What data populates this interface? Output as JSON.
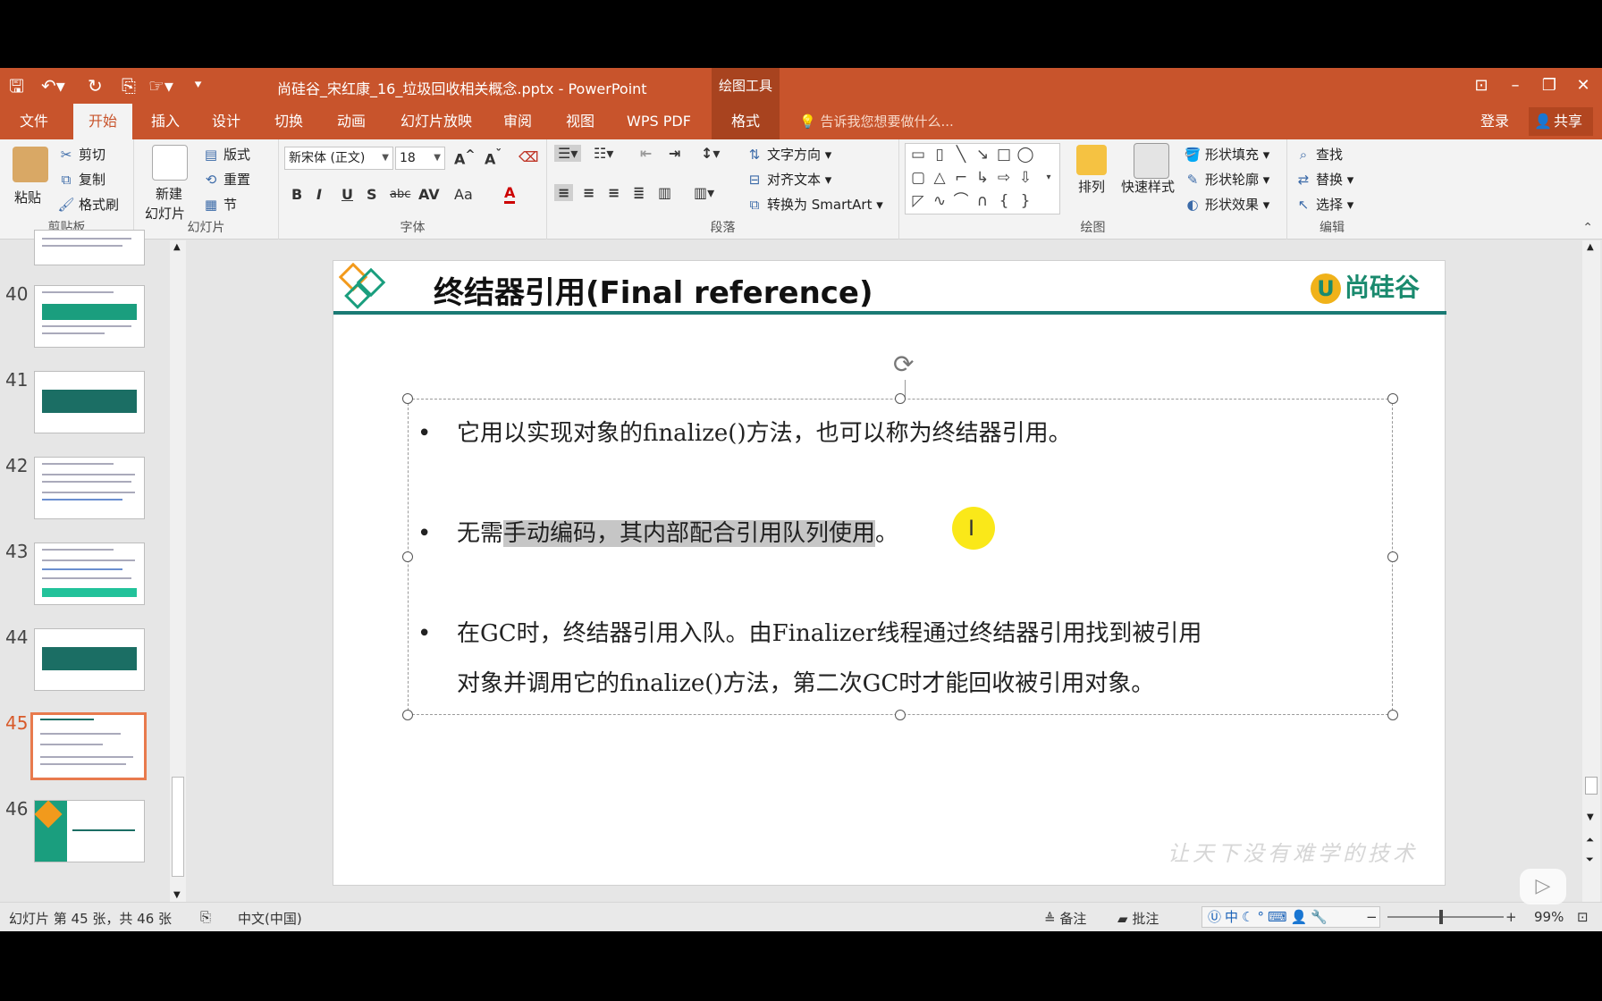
{
  "titlebar": {
    "doc_title": "尚硅谷_宋红康_16_垃圾回收相关概念.pptx - PowerPoint",
    "context_title": "绘图工具",
    "save_icon": "save-icon",
    "undo_icon": "undo-icon",
    "redo_icon": "redo-icon"
  },
  "tabs": [
    "文件",
    "开始",
    "插入",
    "设计",
    "切换",
    "动画",
    "幻灯片放映",
    "审阅",
    "视图",
    "WPS PDF",
    "格式"
  ],
  "active_tab": "开始",
  "tellme": "告诉我您想要做什么...",
  "account": {
    "login": "登录",
    "share": "共享"
  },
  "ribbon": {
    "clipboard": {
      "label": "剪贴板",
      "paste": "粘贴",
      "cut": "剪切",
      "copy": "复制",
      "painter": "格式刷"
    },
    "slides": {
      "label": "幻灯片",
      "new_slide_1": "新建",
      "new_slide_2": "幻灯片",
      "layout": "版式",
      "reset": "重置",
      "section": "节"
    },
    "font": {
      "label": "字体",
      "font_name": "新宋体 (正文)",
      "font_size": "18",
      "bold": "B",
      "italic": "I",
      "underline": "U",
      "shadow": "S",
      "strike": "abc",
      "spacing": "AV",
      "case": "Aa",
      "color": "A"
    },
    "paragraph": {
      "label": "段落",
      "text_direction": "文字方向",
      "align_text": "对齐文本",
      "smartart": "转换为 SmartArt"
    },
    "drawing": {
      "label": "绘图",
      "arrange": "排列",
      "quick_styles": "快速样式",
      "shape_fill": "形状填充",
      "shape_outline": "形状轮廓",
      "shape_effects": "形状效果"
    },
    "editing": {
      "label": "编辑",
      "find": "查找",
      "replace": "替换",
      "select": "选择"
    }
  },
  "thumbnails": [
    {
      "num": "40",
      "kind": "content-bar"
    },
    {
      "num": "41",
      "kind": "section"
    },
    {
      "num": "42",
      "kind": "content"
    },
    {
      "num": "43",
      "kind": "content-bottom"
    },
    {
      "num": "44",
      "kind": "section"
    },
    {
      "num": "45",
      "kind": "content",
      "selected": true
    },
    {
      "num": "46",
      "kind": "end"
    }
  ],
  "slide": {
    "title": "终结器引用(Final reference)",
    "logo_text": "尚硅谷",
    "watermark": "让天下没有难学的技术",
    "bullets": [
      {
        "text": "它用以实现对象的finalize()方法，也可以称为终结器引用。"
      },
      {
        "pre": "无需",
        "highlight": "手动编码，其内部配合引用队列使用",
        "post": "。"
      },
      {
        "line1": "在GC时，终结器引用入队。由Finalizer线程通过终结器引用找到被引用",
        "line2": "对象并调用它的finalize()方法，第二次GC时才能回收被引用对象。"
      }
    ]
  },
  "statusbar": {
    "slide_info": "幻灯片 第 45 张，共 46 张",
    "language": "中文(中国)",
    "notes": "备注",
    "comments": "批注",
    "zoom": "99%",
    "ime": "中"
  }
}
